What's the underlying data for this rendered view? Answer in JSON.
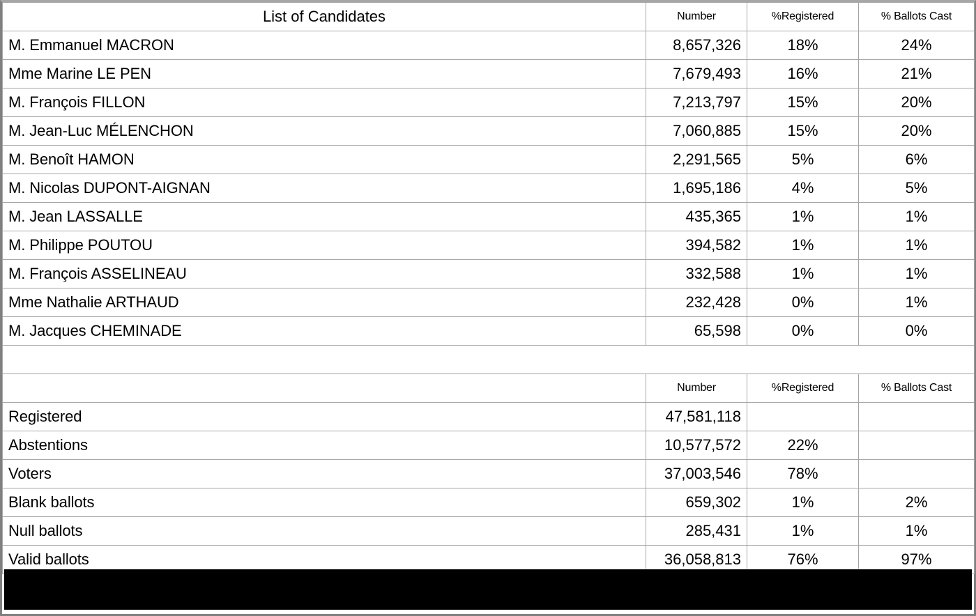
{
  "columns": {
    "candidates_title": "List of Candidates",
    "number": "Number",
    "pct_registered": "%Registered",
    "pct_ballots_cast": "% Ballots Cast"
  },
  "candidates_table": {
    "rows": [
      {
        "name": "M. Emmanuel MACRON",
        "number": "8,657,326",
        "pct_registered": "18%",
        "pct_ballots_cast": "24%"
      },
      {
        "name": "Mme Marine LE PEN",
        "number": "7,679,493",
        "pct_registered": "16%",
        "pct_ballots_cast": "21%"
      },
      {
        "name": "M. François FILLON",
        "number": "7,213,797",
        "pct_registered": "15%",
        "pct_ballots_cast": "20%"
      },
      {
        "name": "M. Jean-Luc MÉLENCHON",
        "number": "7,060,885",
        "pct_registered": "15%",
        "pct_ballots_cast": "20%"
      },
      {
        "name": "M. Benoît HAMON",
        "number": "2,291,565",
        "pct_registered": "5%",
        "pct_ballots_cast": "6%"
      },
      {
        "name": "M. Nicolas DUPONT-AIGNAN",
        "number": "1,695,186",
        "pct_registered": "4%",
        "pct_ballots_cast": "5%"
      },
      {
        "name": "M. Jean LASSALLE",
        "number": "435,365",
        "pct_registered": "1%",
        "pct_ballots_cast": "1%"
      },
      {
        "name": "M. Philippe POUTOU",
        "number": "394,582",
        "pct_registered": "1%",
        "pct_ballots_cast": "1%"
      },
      {
        "name": "M. François ASSELINEAU",
        "number": "332,588",
        "pct_registered": "1%",
        "pct_ballots_cast": "1%"
      },
      {
        "name": "Mme Nathalie ARTHAUD",
        "number": "232,428",
        "pct_registered": "0%",
        "pct_ballots_cast": "1%"
      },
      {
        "name": "M. Jacques CHEMINADE",
        "number": "65,598",
        "pct_registered": "0%",
        "pct_ballots_cast": "0%"
      }
    ]
  },
  "turnout_table": {
    "header_label": "",
    "rows": [
      {
        "name": "Registered",
        "number": "47,581,118",
        "pct_registered": "",
        "pct_ballots_cast": ""
      },
      {
        "name": "Abstentions",
        "number": "10,577,572",
        "pct_registered": "22%",
        "pct_ballots_cast": ""
      },
      {
        "name": "Voters",
        "number": "37,003,546",
        "pct_registered": "78%",
        "pct_ballots_cast": ""
      },
      {
        "name": "Blank ballots",
        "number": "659,302",
        "pct_registered": "1%",
        "pct_ballots_cast": "2%"
      },
      {
        "name": "Null ballots",
        "number": "285,431",
        "pct_registered": "1%",
        "pct_ballots_cast": "1%"
      },
      {
        "name": "Valid ballots",
        "number": "36,058,813",
        "pct_registered": "76%",
        "pct_ballots_cast": "97%"
      }
    ]
  },
  "chart_data": {
    "type": "table",
    "title": "List of Candidates",
    "columns": [
      "List of Candidates",
      "Number",
      "%Registered",
      "% Ballots Cast"
    ],
    "rows": [
      [
        "M. Emmanuel MACRON",
        8657326,
        18,
        24
      ],
      [
        "Mme Marine LE PEN",
        7679493,
        16,
        21
      ],
      [
        "M. François FILLON",
        7213797,
        15,
        20
      ],
      [
        "M. Jean-Luc MÉLENCHON",
        7060885,
        15,
        20
      ],
      [
        "M. Benoît HAMON",
        2291565,
        5,
        6
      ],
      [
        "M. Nicolas DUPONT-AIGNAN",
        1695186,
        4,
        5
      ],
      [
        "M. Jean LASSALLE",
        435365,
        1,
        1
      ],
      [
        "M. Philippe POUTOU",
        394582,
        1,
        1
      ],
      [
        "M. François ASSELINEAU",
        332588,
        1,
        1
      ],
      [
        "Mme Nathalie ARTHAUD",
        232428,
        0,
        1
      ],
      [
        "M. Jacques CHEMINADE",
        65598,
        0,
        0
      ]
    ],
    "summary_rows": [
      [
        "Registered",
        47581118,
        null,
        null
      ],
      [
        "Abstentions",
        10577572,
        22,
        null
      ],
      [
        "Voters",
        37003546,
        78,
        null
      ],
      [
        "Blank ballots",
        659302,
        1,
        2
      ],
      [
        "Null ballots",
        285431,
        1,
        1
      ],
      [
        "Valid ballots",
        36058813,
        76,
        97
      ]
    ]
  }
}
